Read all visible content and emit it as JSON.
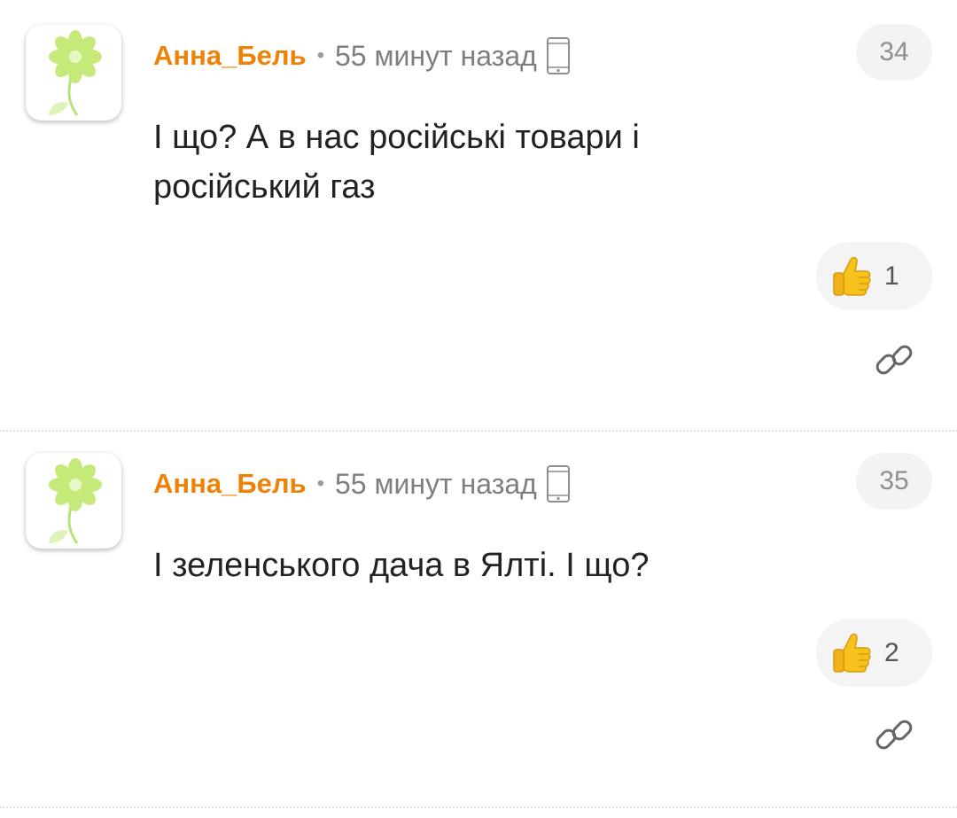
{
  "comments": [
    {
      "author": "Анна_Бель",
      "separator": "•",
      "time": "55 минут назад",
      "device_icon": "mobile-phone-icon",
      "number": "34",
      "text_lines": [
        "І що? А в нас російські товари і",
        "російський газ"
      ],
      "likes": "1",
      "like_icon": "thumbs-up-icon",
      "link_icon": "link-icon"
    },
    {
      "author": "Анна_Бель",
      "separator": "•",
      "time": "55 минут назад",
      "device_icon": "mobile-phone-icon",
      "number": "35",
      "text_lines": [
        "І зеленського дача в Ялті. І що?"
      ],
      "likes": "2",
      "like_icon": "thumbs-up-icon",
      "link_icon": "link-icon"
    }
  ],
  "colors": {
    "author": "#ee8208",
    "meta_text": "#7e7e7e",
    "badge_bg": "#f3f3f4",
    "thumb": "#f7c21b",
    "avatar_flower": "#c6ea7a"
  }
}
